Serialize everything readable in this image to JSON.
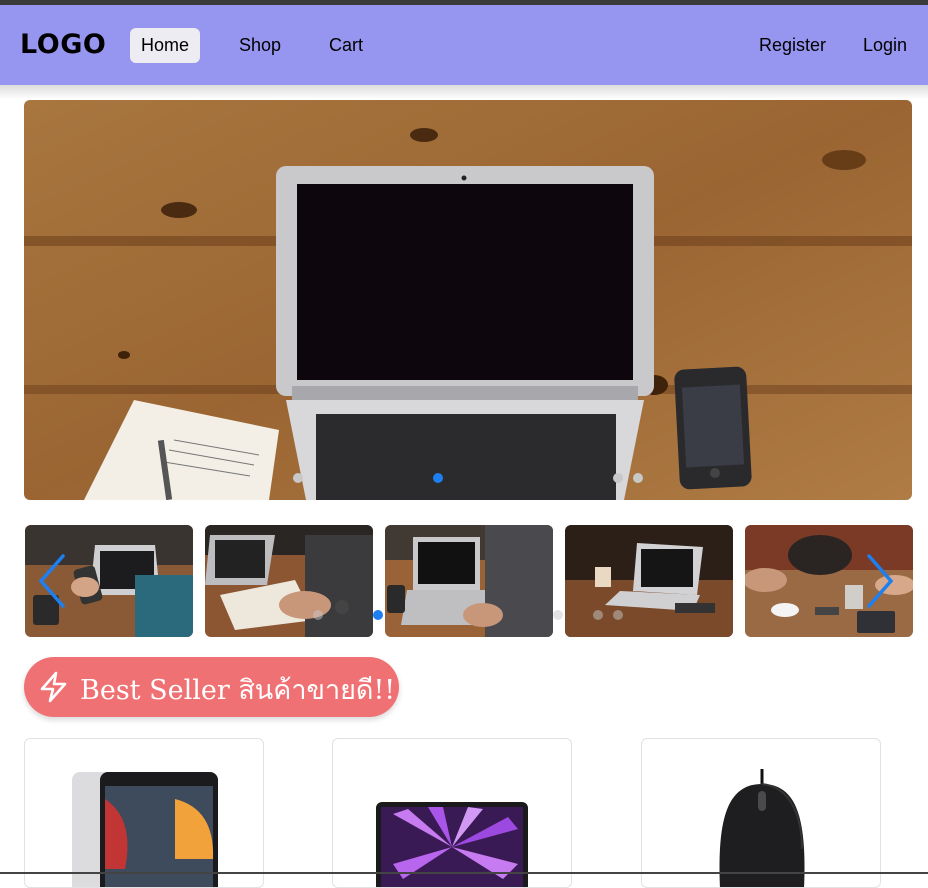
{
  "navbar": {
    "logo": "LOGO",
    "links": [
      {
        "label": "Home",
        "active": true
      },
      {
        "label": "Shop",
        "active": false
      },
      {
        "label": "Cart",
        "active": false
      }
    ],
    "auth": {
      "register": "Register",
      "login": "Login"
    },
    "background": "#9696f0"
  },
  "hero": {
    "image": "laptop-on-wooden-desk",
    "slide_count": 4,
    "active_slide": 2
  },
  "thumbnails": {
    "items": [
      {
        "image": "person-using-phone-with-laptop"
      },
      {
        "image": "hands-writing-near-laptop"
      },
      {
        "image": "person-typing-on-laptop"
      },
      {
        "image": "laptop-on-cafe-table"
      },
      {
        "image": "people-at-table-with-tablet"
      }
    ],
    "prev_icon": "chevron-left-icon",
    "next_icon": "chevron-right-icon",
    "accent": "#1d7ff0"
  },
  "best_seller": {
    "icon": "lightning-icon",
    "title": "Best Seller สินค้าขายดี!!",
    "color": "#f07173"
  },
  "products": [
    {
      "image": "ipad"
    },
    {
      "image": "macbook-air"
    },
    {
      "image": "computer-mouse"
    }
  ]
}
